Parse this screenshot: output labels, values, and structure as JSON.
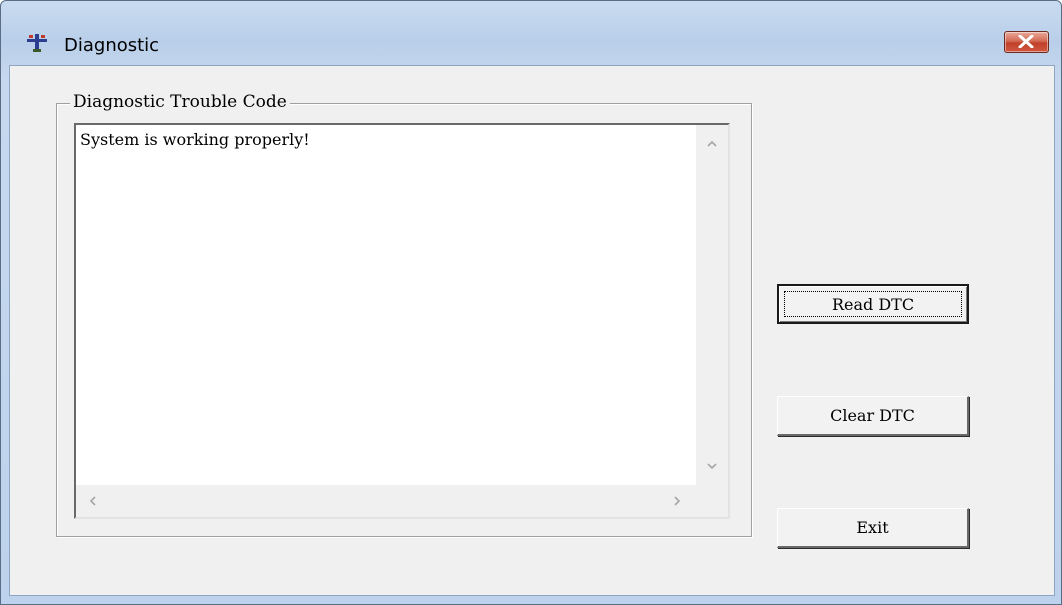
{
  "window": {
    "title": "Diagnostic",
    "icon": "airplane-icon",
    "close_icon": "close-x-icon"
  },
  "group": {
    "label": "Diagnostic Trouble Code",
    "text": "System is working properly!"
  },
  "buttons": {
    "read_dtc": "Read DTC",
    "clear_dtc": "Clear DTC",
    "exit": "Exit"
  },
  "colors": {
    "title_bar": "#c0d4ec",
    "close_button": "#c9493a",
    "client_bg": "#f0f0f0"
  }
}
